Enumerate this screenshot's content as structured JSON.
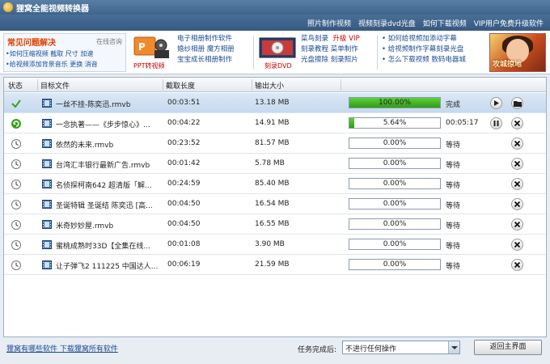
{
  "app": {
    "title": "狸窝全能视频转换器"
  },
  "menu": {
    "items": [
      "照片制作视频",
      "视频刻录dvd光盘",
      "如何下载视频",
      "VIP用户免费升级软件"
    ]
  },
  "faq": {
    "title": "常见问题解决",
    "online": "在线咨询",
    "line1": "•如何压缩视频  截取  尺寸  加速",
    "line2": "•给视频添加背景音乐  更换  消音"
  },
  "promo": {
    "ppt_label": "PPT转视频",
    "col1": [
      "电子相册制作软件",
      "婚纱相册  魔方相册",
      "宝宝成长相册制作"
    ],
    "dvd_label": "刻录DVD",
    "col2_line1_a": "菜鸟刻录",
    "col2_line1_b": "升级 VIP",
    "col2": [
      "刻录教程  菜单制作",
      "光盘擦除  刻录照片"
    ],
    "col3": [
      "• 如何给视频加添动字幕",
      "• 给视频制作字幕刻录光盘",
      "• 怎么下载视频  数码电器城"
    ],
    "game_text": "攻城掠地"
  },
  "table": {
    "headers": {
      "status": "状态",
      "file": "目标文件",
      "length": "截取长度",
      "size": "输出大小"
    },
    "rows": [
      {
        "status": "done",
        "name": "一丝不挂-陈奕迅.rmvb",
        "length": "00:03:51",
        "size": "13.18 MB",
        "progress": 1.0,
        "progress_text": "100.00%",
        "state": "完成",
        "time": "",
        "actions": [
          "play",
          "folder"
        ]
      },
      {
        "status": "converting",
        "name": "一念执著——《步步惊心》...",
        "length": "00:04:22",
        "size": "14.91 MB",
        "progress": 0.0564,
        "progress_text": "5.64%",
        "state": "",
        "time": "00:05:17",
        "actions": [
          "pause",
          "close"
        ]
      },
      {
        "status": "waiting",
        "name": "依然的未来.rmvb",
        "length": "00:23:52",
        "size": "81.57 MB",
        "progress": 0,
        "progress_text": "0.00%",
        "state": "等待",
        "time": "",
        "actions": [
          "close"
        ]
      },
      {
        "status": "waiting",
        "name": "台湾汇丰银行最新广告.rmvb",
        "length": "00:01:42",
        "size": "5.78 MB",
        "progress": 0,
        "progress_text": "0.00%",
        "state": "等待",
        "time": "",
        "actions": [
          "close"
        ]
      },
      {
        "status": "waiting",
        "name": "名侦探柯南642 超清版「解...",
        "length": "00:24:59",
        "size": "85.40 MB",
        "progress": 0,
        "progress_text": "0.00%",
        "state": "等待",
        "time": "",
        "actions": [
          "close"
        ]
      },
      {
        "status": "waiting",
        "name": "圣诞特辑 圣诞结 陈奕迅 [高...",
        "length": "00:04:50",
        "size": "16.54 MB",
        "progress": 0,
        "progress_text": "0.00%",
        "state": "等待",
        "time": "",
        "actions": [
          "close"
        ]
      },
      {
        "status": "waiting",
        "name": "米奇妙妙屋.rmvb",
        "length": "00:04:50",
        "size": "16.55 MB",
        "progress": 0,
        "progress_text": "0.00%",
        "state": "等待",
        "time": "",
        "actions": [
          "close"
        ]
      },
      {
        "status": "waiting",
        "name": "蜜桃成熟时33D【全集在线...",
        "length": "00:01:08",
        "size": "3.90 MB",
        "progress": 0,
        "progress_text": "0.00%",
        "state": "等待",
        "time": "",
        "actions": [
          "close"
        ]
      },
      {
        "status": "waiting",
        "name": "让子弹飞2 111225 中国达人...",
        "length": "00:06:19",
        "size": "21.59 MB",
        "progress": 0,
        "progress_text": "0.00%",
        "state": "等待",
        "time": "",
        "actions": [
          "close"
        ]
      }
    ]
  },
  "footer": {
    "link": "狸窝有哪些软件 下载狸窝所有软件",
    "after_label": "任务完成后:",
    "after_value": "不进行任何操作",
    "back_button": "返回主界面"
  },
  "colors": {
    "progress_fill": "#3fb521",
    "link": "#1d4b91",
    "faq_title": "#e24000"
  }
}
